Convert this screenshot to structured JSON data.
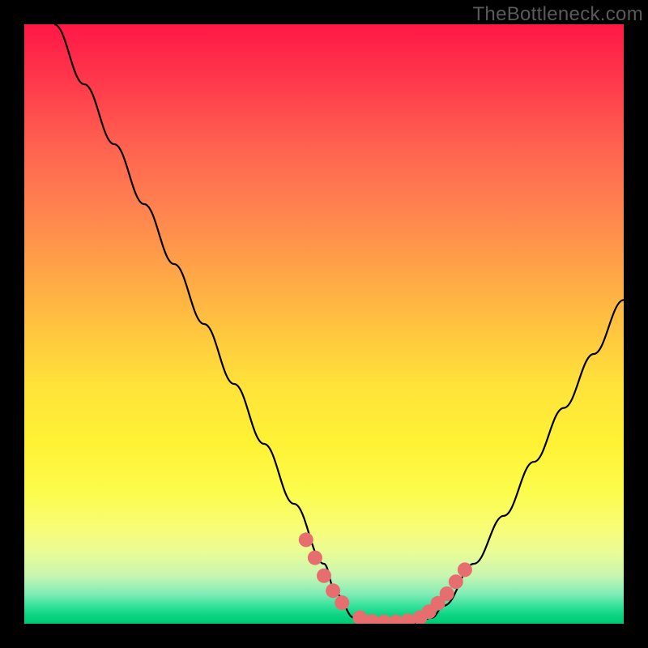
{
  "watermark": "TheBottleneck.com",
  "chart_data": {
    "type": "line",
    "title": "",
    "xlabel": "",
    "ylabel": "",
    "xlim": [
      0,
      100
    ],
    "ylim": [
      0,
      100
    ],
    "series": [
      {
        "name": "bottleneck-curve",
        "x": [
          5,
          10,
          15,
          20,
          25,
          30,
          35,
          40,
          45,
          50,
          52,
          55,
          58,
          60,
          63,
          65,
          68,
          70,
          75,
          80,
          85,
          90,
          95,
          100
        ],
        "y": [
          100,
          90,
          80,
          70,
          60,
          50,
          40,
          30,
          20,
          10,
          5,
          1,
          0,
          0,
          0,
          0,
          1,
          3,
          10,
          18,
          27,
          36,
          45,
          54
        ]
      }
    ],
    "markers": [
      {
        "name": "highlight-dots",
        "color": "#e76e6e",
        "x": [
          47,
          48.5,
          50,
          51.5,
          53,
          56,
          58,
          60,
          62,
          64,
          66,
          67.5,
          69,
          70.5,
          72,
          73.5
        ],
        "y": [
          14,
          11,
          8,
          5.5,
          3.5,
          1,
          0.4,
          0.3,
          0.3,
          0.5,
          1,
          2,
          3.4,
          5,
          7,
          9
        ]
      }
    ]
  }
}
